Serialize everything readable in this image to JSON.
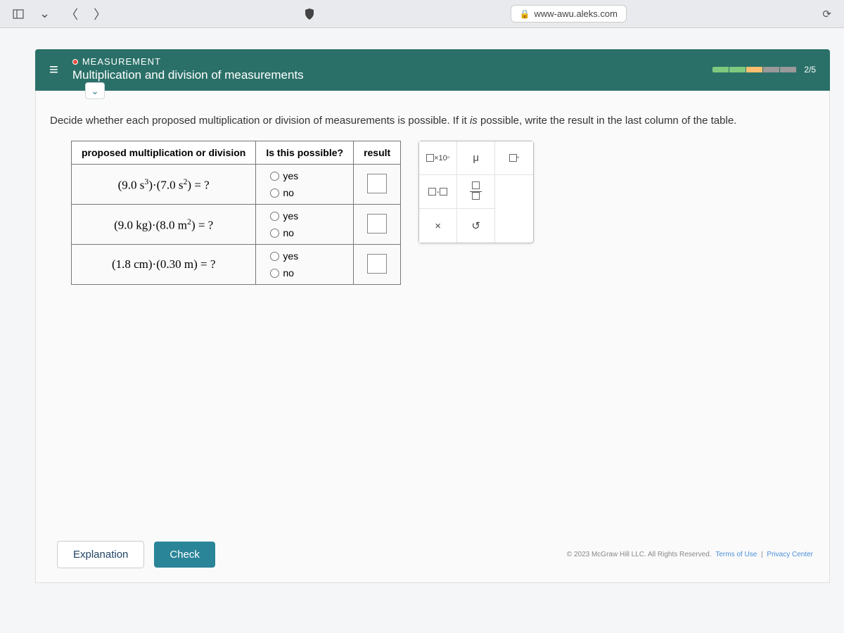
{
  "browser": {
    "url": "www-awu.aleks.com"
  },
  "header": {
    "category": "MEASUREMENT",
    "title": "Multiplication and division of measurements",
    "progress_label": "2/5"
  },
  "instruction_prefix": "Decide whether each proposed multiplication or division of measurements is possible. If it ",
  "instruction_em": "is",
  "instruction_suffix": " possible, write the result in the last column of the table.",
  "table": {
    "col1": "proposed multiplication or division",
    "col2": "Is this possible?",
    "col3": "result",
    "yes": "yes",
    "no": "no",
    "rows": [
      {
        "expr_html": "(9.0 s<sup>3</sup>)·(7.0 s<sup>2</sup>) = ?"
      },
      {
        "expr_html": "(9.0 kg)·(8.0 m<sup>2</sup>) = ?"
      },
      {
        "expr_html": "(1.8 cm)·(0.30 m) = ?"
      }
    ]
  },
  "keypad": {
    "x10": "×10",
    "mu": "μ",
    "dot": "·",
    "times": "×",
    "undo": "↺"
  },
  "buttons": {
    "explanation": "Explanation",
    "check": "Check"
  },
  "footer": {
    "copyright": "© 2023 McGraw Hill LLC. All Rights Reserved.",
    "terms": "Terms of Use",
    "privacy": "Privacy Center"
  }
}
